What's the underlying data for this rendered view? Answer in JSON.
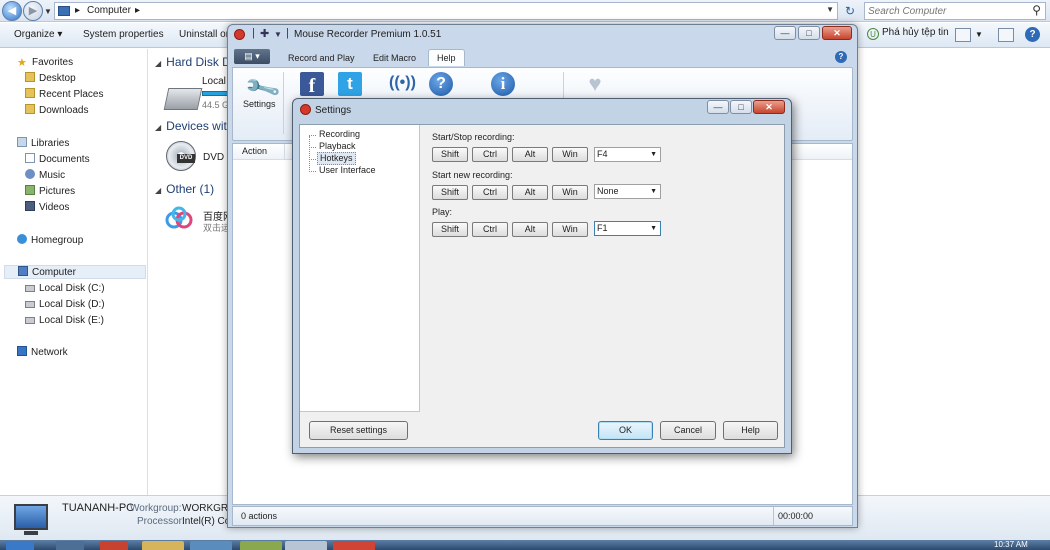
{
  "explorer": {
    "address": {
      "crumb": "Computer",
      "dropdown_icon": "chevron-down-icon"
    },
    "search": {
      "placeholder": "Search Computer"
    },
    "commands": {
      "organize": "Organize ▾",
      "system_properties": "System properties",
      "uninstall": "Uninstall or",
      "uninstall_right": "Phá hủy tệp tin"
    },
    "nav": {
      "favorites": "Favorites",
      "desktop": "Desktop",
      "recent_places": "Recent Places",
      "downloads": "Downloads",
      "libraries": "Libraries",
      "documents": "Documents",
      "music": "Music",
      "pictures": "Pictures",
      "videos": "Videos",
      "homegroup": "Homegroup",
      "computer": "Computer",
      "local_c": "Local Disk (C:)",
      "local_d": "Local Disk (D:)",
      "local_e": "Local Disk (E:)",
      "network": "Network"
    },
    "groups": {
      "hard_disk": "Hard Disk Dr",
      "devices": "Devices with",
      "other": "Other (1)"
    },
    "items": {
      "local_disk_label": "Local",
      "local_disk_size": "44.5 G",
      "dvd_label": "DVD R",
      "dvd_tag": "DVD",
      "baidu_label": "百度网",
      "baidu_sub": "双击运"
    },
    "details": {
      "pc_name": "TUANANH-PC",
      "workgroup_key": "Workgroup:",
      "workgroup_value": "WORKGRO",
      "processor_key": "Processor:",
      "processor_value": "Intel(R) Co"
    }
  },
  "mouse_recorder": {
    "title": "Mouse Recorder Premium 1.0.51",
    "tabs": [
      "Record and Play",
      "Edit Macro",
      "Help"
    ],
    "active_tab": "Help",
    "ribbon_settings_label": "Settings",
    "column_action": "Action",
    "status_actions": "0 actions",
    "status_time": "00:00:00"
  },
  "settings_dialog": {
    "title": "Settings",
    "tree": [
      "Recording",
      "Playback",
      "Hotkeys",
      "User Interface"
    ],
    "selected": "Hotkeys",
    "modifiers": [
      "Shift",
      "Ctrl",
      "Alt",
      "Win"
    ],
    "sections": [
      {
        "label": "Start/Stop recording:",
        "key": "F4"
      },
      {
        "label": "Start new recording:",
        "key": "None"
      },
      {
        "label": "Play:",
        "key": "F1"
      }
    ],
    "buttons": {
      "reset": "Reset settings",
      "ok": "OK",
      "cancel": "Cancel",
      "help": "Help"
    }
  },
  "taskbar": {
    "clock": "10:37 AM"
  }
}
